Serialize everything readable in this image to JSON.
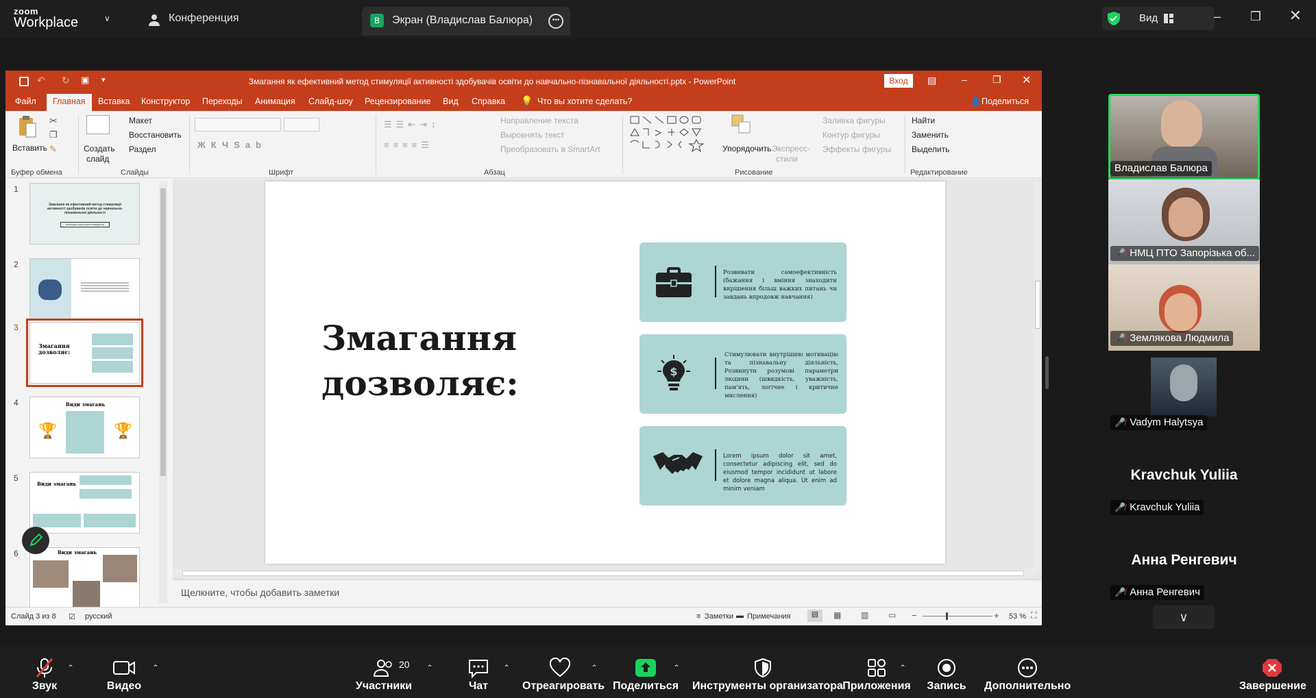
{
  "zoom_header": {
    "brand_line1": "zoom",
    "brand_line2": "Workplace",
    "meeting_label": "Конференция",
    "screen_badge": "B",
    "screen_tab_label": "Экран (Владислав Балюра)",
    "view_label": "Вид"
  },
  "ppt": {
    "title": "Змагання як ефективний метод стимуляції активності здобувачів освіти до навчально-пізнавальної діяльності.pptx  -  PowerPoint",
    "signin": "Вход",
    "tabs": [
      "Файл",
      "Главная",
      "Вставка",
      "Конструктор",
      "Переходы",
      "Анимация",
      "Слайд-шоу",
      "Рецензирование",
      "Вид",
      "Справка",
      "Что вы хотите сделать?"
    ],
    "share": "Поделиться",
    "ribbon": {
      "paste": "Вставить",
      "clipboard_group": "Буфер обмена",
      "new_slide_1": "Создать",
      "new_slide_2": "слайд",
      "layout": "Макет",
      "reset": "Восстановить",
      "section": "Раздел",
      "slides_group": "Слайды",
      "font_group": "Шрифт",
      "text_direction": "Направление текста",
      "align_text": "Выровнять текст",
      "smartart": "Преобразовать в SmartArt",
      "paragraph_group": "Абзац",
      "arrange": "Упорядочить",
      "quick_styles_1": "Экспресс-",
      "quick_styles_2": "стили",
      "shape_fill": "Заливка фигуры",
      "shape_outline": "Контур фигуры",
      "shape_effects": "Эффекты фигуры",
      "drawing_group": "Рисование",
      "find": "Найти",
      "replace": "Заменить",
      "select": "Выделить",
      "editing_group": "Редактирование"
    },
    "thumbnails": [
      {
        "num": "1",
        "title": "Змагання як ефективний метод стимуляції активності здобувачів освіти до навчально-пізнавальної діяльності",
        "sub": "ВИКЛАДАЧ НАВЧАЛЬНИХ ПРЕДМЕТІВ"
      },
      {
        "num": "2",
        "title": ""
      },
      {
        "num": "3",
        "title": "Змагання дозволяє:"
      },
      {
        "num": "4",
        "title": "Види змагань"
      },
      {
        "num": "5",
        "title": "Види змагань"
      },
      {
        "num": "6",
        "title": "Види змагань"
      }
    ],
    "slide": {
      "heading_line1": "Змагання",
      "heading_line2": "дозволяє:",
      "cards": [
        {
          "icon": "briefcase-icon",
          "text": "Розвивати самоефективність (бажання і вміння знаходити вирішення більш важких питань чи завдань впродовж навчання)"
        },
        {
          "icon": "lightbulb-dollar-icon",
          "text": "Стимулювати внутрішню мотивацію та пізнавальну діяльність, Розвинути розумові параметри людини (швидкість, уважність, пам'ять, логічне і критичне мислення)"
        },
        {
          "icon": "handshake-icon",
          "text": "Lorem ipsum dolor sit amet, consectetur adipiscing elit, sed do eiusmod tempor incididunt ut labore et dolore magna aliqua. Ut enim ad minim veniam"
        }
      ]
    },
    "notes_placeholder": "Щелкните, чтобы добавить заметки",
    "status": {
      "slide_info": "Слайд 3 из 8",
      "language": "русский",
      "notes_btn": "Заметки",
      "comments_btn": "Примечания",
      "zoom_level": "53 %"
    }
  },
  "participants": [
    {
      "name": "Владислав Балюра",
      "muted": false,
      "video": true
    },
    {
      "name": "НМЦ ПТО Запорізька об...",
      "muted": true,
      "video": true
    },
    {
      "name": "Землякова Людмила",
      "muted": true,
      "video": true
    },
    {
      "name": "Vadym Halytsya",
      "muted": true,
      "video": true
    },
    {
      "name": "Kravchuk Yuliia",
      "display": "Kravchuk Yuliia",
      "muted": true,
      "video": false
    },
    {
      "name": "Анна Ренгевич",
      "display": "Анна Ренгевич",
      "muted": true,
      "video": false
    }
  ],
  "toolbar": {
    "audio": "Звук",
    "video": "Видео",
    "participants": "Участники",
    "participants_count": "20",
    "chat": "Чат",
    "react": "Отреагировать",
    "share": "Поделиться",
    "host_tools": "Инструменты организатора",
    "apps": "Приложения",
    "record": "Запись",
    "more": "Дополнительно",
    "end": "Завершение"
  },
  "colors": {
    "ppt_accent": "#c43e1c",
    "card_teal": "#acd5d3",
    "share_green": "#1dd35e",
    "end_red": "#e0393e",
    "active_speaker": "#23d959"
  }
}
